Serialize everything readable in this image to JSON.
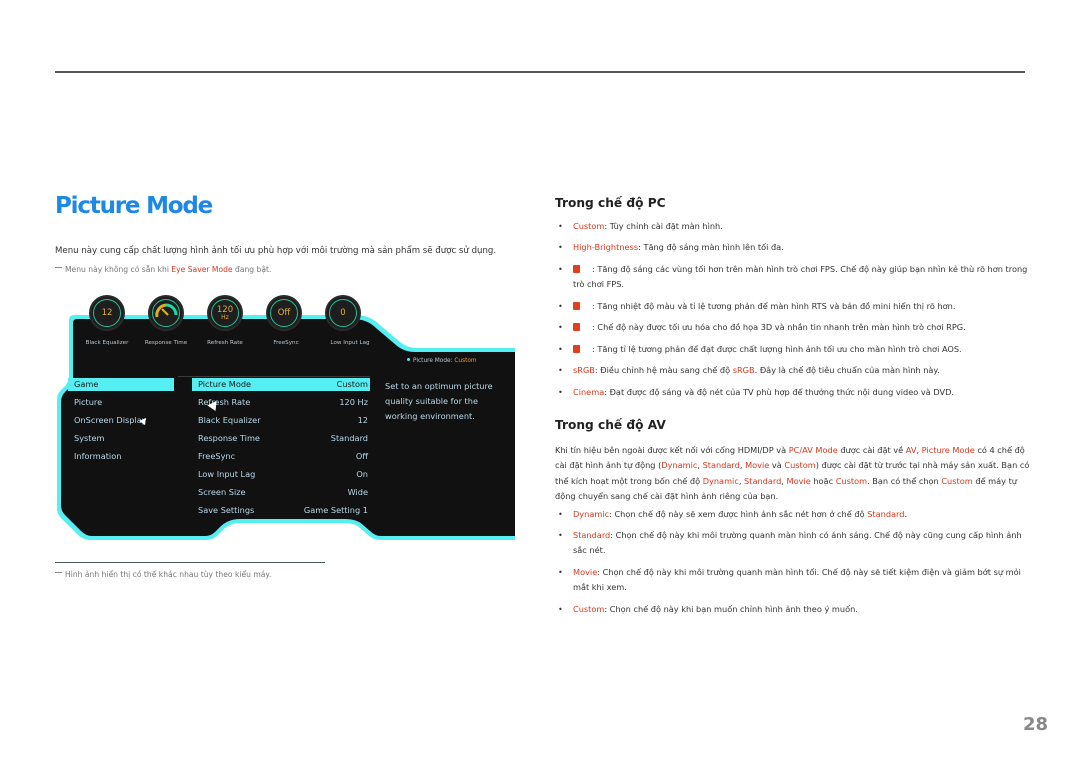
{
  "page": {
    "title": "Picture Mode",
    "intro": "Menu này cung cấp chất lượng hình ảnh tối ưu phù hợp với môi trường mà sản phẩm sẽ được sử dụng.",
    "note": {
      "prefix": "Menu này không có sẵn khi ",
      "highlight": "Eye Saver Mode",
      "suffix": " đang bật."
    },
    "figure_note": "Hình ảnh hiển thị có thể khác nhau tùy theo kiểu máy.",
    "page_number": "28",
    "highlight_color": "#d9381e",
    "title_color": "#1e88e5"
  },
  "osd": {
    "accent_color": "#55eef2",
    "dials": [
      {
        "name": "black-equalizer",
        "value": "12",
        "unit": "",
        "label": "Black Equalizer"
      },
      {
        "name": "response-time",
        "value": "",
        "unit": "",
        "label": "Response Time",
        "gauge": true
      },
      {
        "name": "refresh-rate",
        "value": "120",
        "unit": "Hz",
        "label": "Refresh Rate"
      },
      {
        "name": "freesync",
        "value": "Off",
        "unit": "",
        "label": "FreeSync"
      },
      {
        "name": "low-input-lag",
        "value": "0",
        "unit": "",
        "label": "Low Input Lag"
      }
    ],
    "status": {
      "label": "Picture Mode: ",
      "value": "Custom"
    },
    "categories": [
      {
        "label": "Game",
        "selected": true
      },
      {
        "label": "Picture",
        "selected": false
      },
      {
        "label": "OnScreen Display",
        "selected": false
      },
      {
        "label": "System",
        "selected": false
      },
      {
        "label": "Information",
        "selected": false
      }
    ],
    "options": [
      {
        "label": "Picture Mode",
        "value": "Custom",
        "selected": true
      },
      {
        "label": "Refresh Rate",
        "value": "120 Hz",
        "selected": false
      },
      {
        "label": "Black Equalizer",
        "value": "12",
        "selected": false
      },
      {
        "label": "Response Time",
        "value": "Standard",
        "selected": false
      },
      {
        "label": "FreeSync",
        "value": "Off",
        "selected": false
      },
      {
        "label": "Low Input Lag",
        "value": "On",
        "selected": false
      },
      {
        "label": "Screen Size",
        "value": "Wide",
        "selected": false
      },
      {
        "label": "Save Settings",
        "value": "Game Setting 1",
        "selected": false
      }
    ],
    "description": "Set to an optimum picture quality suitable for the working environment."
  },
  "pc_mode": {
    "heading": "Trong chế độ PC",
    "items": [
      {
        "name": "Custom",
        "text": ": Tùy chỉnh cài đặt màn hình."
      },
      {
        "name": "High-Brightness",
        "text": ": Tăng độ sáng màn hình lên tối đa."
      },
      {
        "icon": "fps-icon",
        "text": ": Tăng độ sáng các vùng tối hơn trên màn hình trò chơi FPS. Chế độ này giúp bạn nhìn kẻ thù rõ hơn trong trò chơi FPS."
      },
      {
        "icon": "rts-icon",
        "text": ": Tăng nhiệt độ màu và tỉ lệ tương phản để màn hình RTS và bản đồ mini hiển thị rõ hơn."
      },
      {
        "icon": "rpg-icon",
        "text": ": Chế độ này được tối ưu hóa cho đồ họa 3D và nhắn tin nhanh trên màn hình trò chơi RPG."
      },
      {
        "icon": "aos-icon",
        "text": ": Tăng tỉ lệ tương phản để đạt được chất lượng hình ảnh tối ưu cho màn hình trò chơi AOS."
      },
      {
        "name": "sRGB",
        "text": ": Điều chỉnh hệ màu sang chế độ ",
        "hl2": "sRGB",
        "text2": ". Đây là chế độ tiêu chuẩn của màn hình này."
      },
      {
        "name": "Cinema",
        "text": ": Đạt được độ sáng và độ nét của TV phù hợp để thưởng thức nội dung video và DVD."
      }
    ]
  },
  "av_mode": {
    "heading": "Trong chế độ AV",
    "para": {
      "p1": "Khi tín hiệu bên ngoài được kết nối với cổng HDMI/DP và ",
      "h1": "PC/AV Mode",
      "p2": " được cài đặt về ",
      "h2": "AV",
      "p3": ", ",
      "h3": "Picture Mode",
      "p4": " có 4 chế độ cài đặt hình ảnh tự động (",
      "h4": "Dynamic",
      "p5": ", ",
      "h5": "Standard",
      "p6": ", ",
      "h6": "Movie",
      "p7": " và ",
      "h7": "Custom",
      "p8": ") được cài đặt từ trước tại nhà máy sản xuất. Bạn có thể kích hoạt một trong bốn chế độ ",
      "h8": "Dynamic",
      "p9": ", ",
      "h9": "Standard",
      "p10": ", ",
      "h10": "Movie",
      "p11": " hoặc ",
      "h11": "Custom",
      "p12": ". Bạn có thể chọn ",
      "h12": "Custom",
      "p13": " để máy tự động chuyển sang chế cài đặt hình ảnh riêng của bạn."
    },
    "items": [
      {
        "name": "Dynamic",
        "text": ": Chọn chế độ này sẽ xem được hình ảnh sắc nét hơn ở chế độ ",
        "hl2": "Standard",
        "text2": "."
      },
      {
        "name": "Standard",
        "text": ": Chọn chế độ này khi môi trường quanh màn hình có ánh sáng. Chế độ này cũng cung cấp hình ảnh sắc nét."
      },
      {
        "name": "Movie",
        "text": ": Chọn chế độ này khi môi trường quanh màn hình tối. Chế độ này sẽ tiết kiệm điện và giảm bớt sự mỏi mắt khi xem."
      },
      {
        "name": "Custom",
        "text": ": Chọn chế độ này khi bạn muốn chỉnh hình ảnh theo ý muốn."
      }
    ]
  }
}
